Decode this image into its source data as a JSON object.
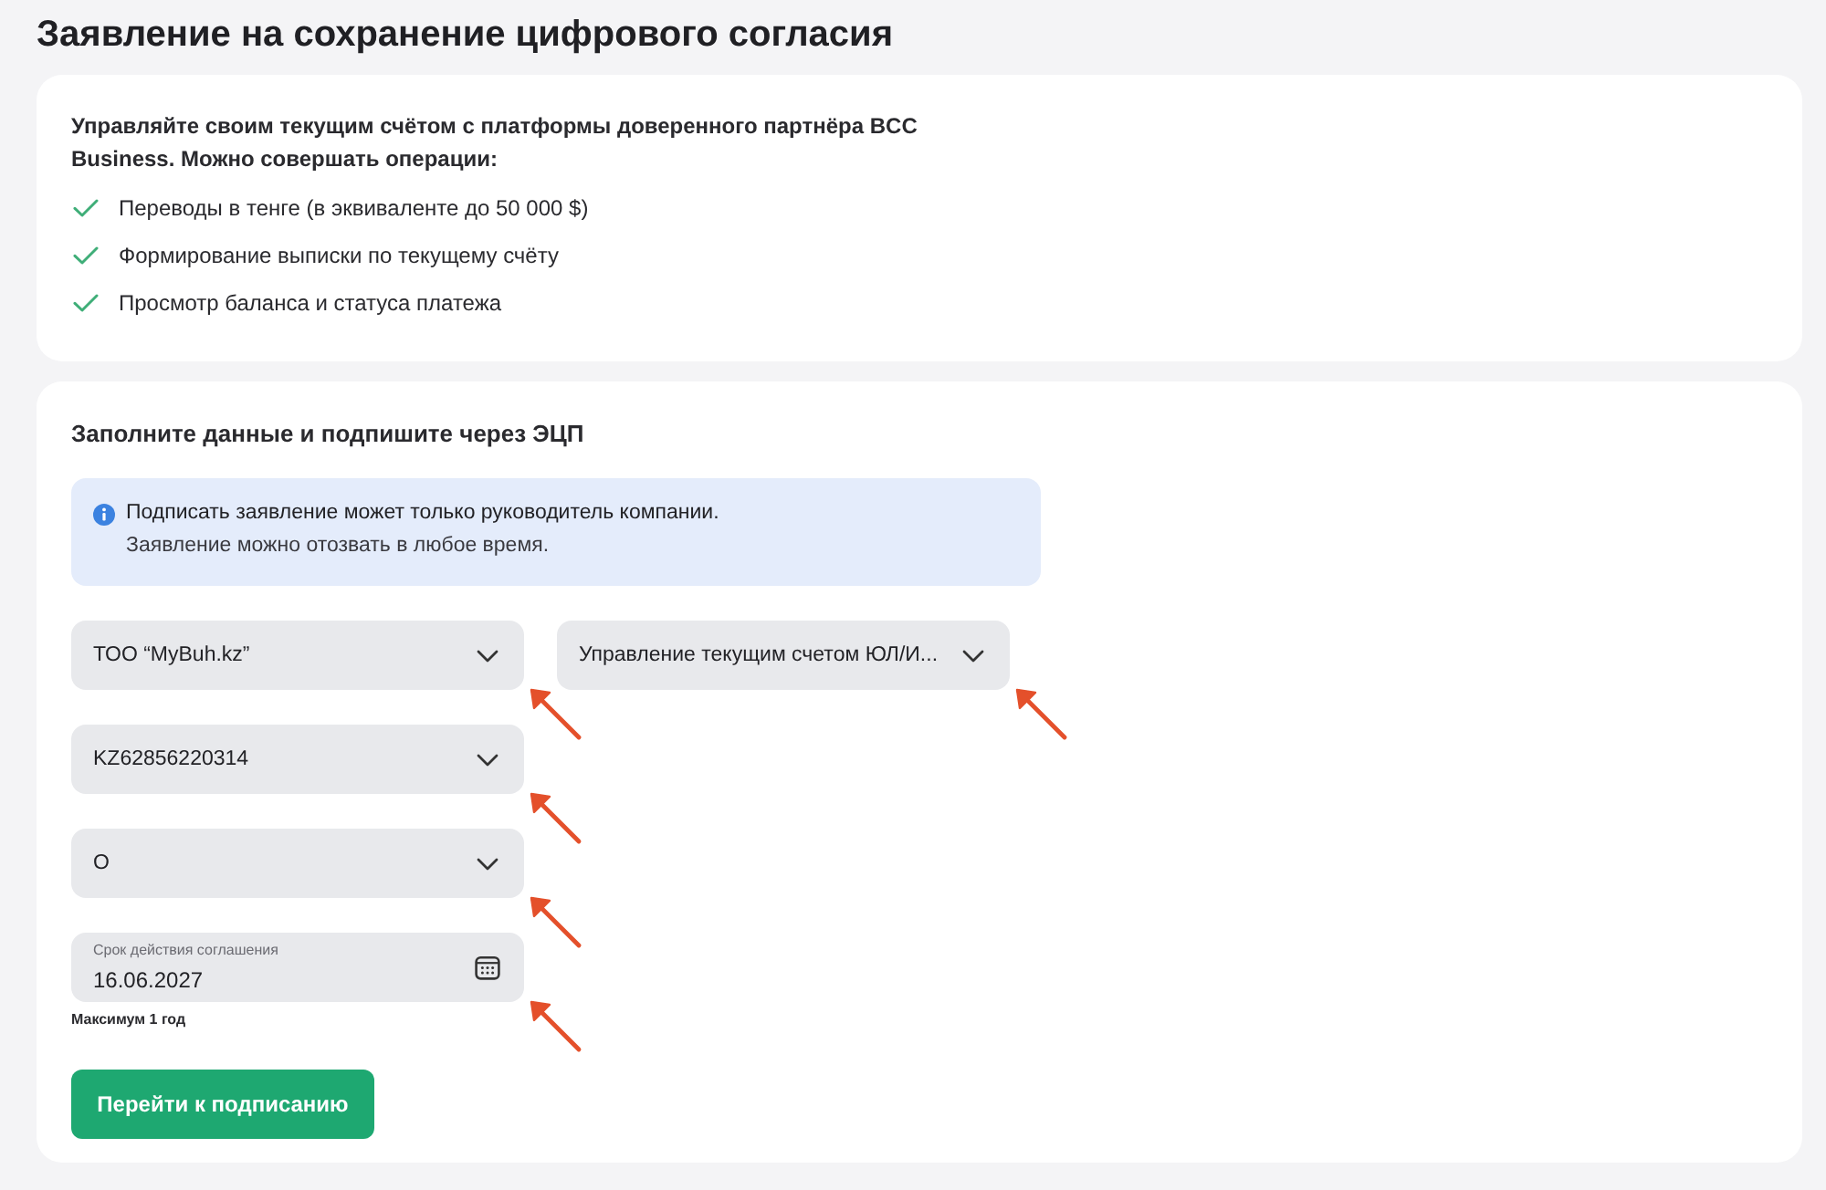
{
  "page": {
    "title": "Заявление на сохранение цифрового согласия"
  },
  "intro_card": {
    "text": "Управляйте своим текущим счётом с платформы доверенного партнёра BCC Business. Можно совершать операции:",
    "operations": [
      "Переводы в тенге (в эквиваленте до 50 000 $)",
      "Формирование выписки по текущему счёту",
      "Просмотр баланса и статуса платежа"
    ]
  },
  "form_card": {
    "heading": "Заполните данные и подпишите через ЭЦП",
    "info": {
      "lines": [
        "Подписать заявление может только руководитель компании.",
        "Заявление можно отозвать в любое время."
      ]
    },
    "rows": [
      [
        {
          "kind": "select",
          "value": "ТОО “MyBuh.kz”",
          "annotated": true
        },
        {
          "kind": "select",
          "value": "Управление текущим счетом ЮЛ/И...",
          "annotated": true
        }
      ],
      [
        {
          "kind": "select",
          "value": "KZ62856220314",
          "annotated": true
        }
      ],
      [
        {
          "kind": "select",
          "value": "О",
          "annotated": true
        }
      ],
      [
        {
          "kind": "date",
          "label": "Срок действия соглашения",
          "value": "16.06.2027",
          "hint": "Максимум 1 год",
          "annotated": true
        }
      ]
    ],
    "submit_button": "Перейти к подписанию"
  }
}
